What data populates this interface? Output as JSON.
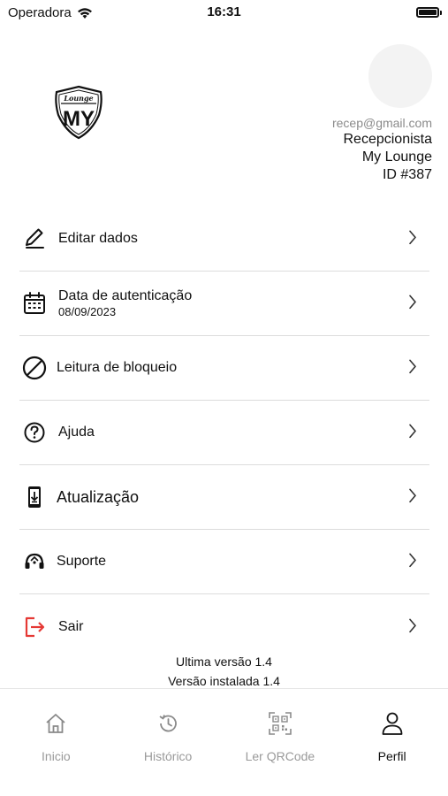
{
  "status_bar": {
    "carrier": "Operadora",
    "time": "16:31"
  },
  "header": {
    "logo_top_text": "Lounge",
    "logo_main_text": "MY",
    "email": "recep@gmail.com",
    "role": "Recepcionista",
    "company": "My Lounge",
    "user_id": "ID #387"
  },
  "menu": {
    "items": [
      {
        "label": "Editar dados",
        "icon": "pencil-icon"
      },
      {
        "label": "Data de autenticação",
        "sublabel": "08/09/2023",
        "icon": "calendar-icon"
      },
      {
        "label": "Leitura de bloqueio",
        "icon": "block-icon"
      },
      {
        "label": "Ajuda",
        "icon": "help-icon"
      },
      {
        "label": "Atualização",
        "icon": "phone-download-icon"
      },
      {
        "label": "Suporte",
        "icon": "headset-icon"
      },
      {
        "label": "Sair",
        "icon": "logout-icon",
        "color": "#e53935"
      }
    ]
  },
  "version": {
    "latest": "Ultima versão 1.4",
    "installed": "Versão instalada 1.4"
  },
  "tab_bar": {
    "tabs": [
      {
        "label": "Inicio",
        "icon": "home-icon",
        "active": false
      },
      {
        "label": "Histórico",
        "icon": "history-icon",
        "active": false
      },
      {
        "label": "Ler QRCode",
        "icon": "qrcode-icon",
        "active": false
      },
      {
        "label": "Perfil",
        "icon": "profile-icon",
        "active": true
      }
    ]
  },
  "colors": {
    "accent_logout": "#e53935",
    "inactive_tab": "#9a9a9a",
    "divider": "#dcdcdc"
  }
}
